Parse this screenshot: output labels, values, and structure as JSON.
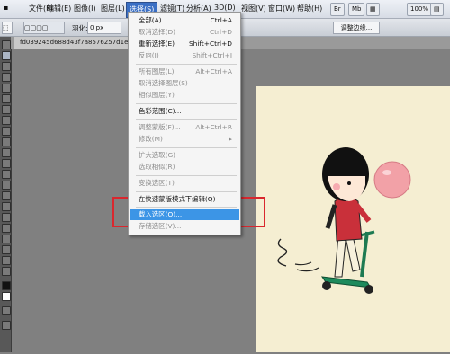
{
  "menubar": {
    "items": [
      "文件(F)",
      "编辑(E)",
      "图像(I)",
      "图层(L)",
      "选择(S)",
      "滤镜(T)",
      "分析(A)",
      "3D(D)",
      "视图(V)",
      "窗口(W)",
      "帮助(H)"
    ],
    "zoom": "100%"
  },
  "optionsbar": {
    "feather_label": "羽化:",
    "feather_value": "0 px",
    "refine_button": "调整边缘..."
  },
  "document": {
    "tab_title": "fd039245d688d43f7a8576257d1ed21"
  },
  "select_menu": {
    "items": [
      {
        "label": "全部(A)",
        "shortcut": "Ctrl+A",
        "enabled": true
      },
      {
        "label": "取消选择(D)",
        "shortcut": "Ctrl+D",
        "enabled": false
      },
      {
        "label": "重新选择(E)",
        "shortcut": "Shift+Ctrl+D",
        "enabled": true
      },
      {
        "label": "反向(I)",
        "shortcut": "Shift+Ctrl+I",
        "enabled": false
      },
      {
        "label": "所有图层(L)",
        "shortcut": "Alt+Ctrl+A",
        "enabled": false
      },
      {
        "label": "取消选择图层(S)",
        "shortcut": "",
        "enabled": false
      },
      {
        "label": "相似图层(Y)",
        "shortcut": "",
        "enabled": false
      },
      {
        "label": "色彩范围(C)...",
        "shortcut": "",
        "enabled": true
      },
      {
        "label": "调整蒙版(F)...",
        "shortcut": "Alt+Ctrl+R",
        "enabled": false
      },
      {
        "label": "修改(M)",
        "shortcut": "▸",
        "enabled": false
      },
      {
        "label": "扩大选取(G)",
        "shortcut": "",
        "enabled": false
      },
      {
        "label": "选取相似(R)",
        "shortcut": "",
        "enabled": false
      },
      {
        "label": "变换选区(T)",
        "shortcut": "",
        "enabled": false
      },
      {
        "label": "在快速蒙版模式下编辑(Q)",
        "shortcut": "",
        "enabled": true
      },
      {
        "label": "载入选区(O)...",
        "shortcut": "",
        "enabled": true,
        "highlighted": true
      },
      {
        "label": "存储选区(V)...",
        "shortcut": "",
        "enabled": false
      }
    ]
  }
}
